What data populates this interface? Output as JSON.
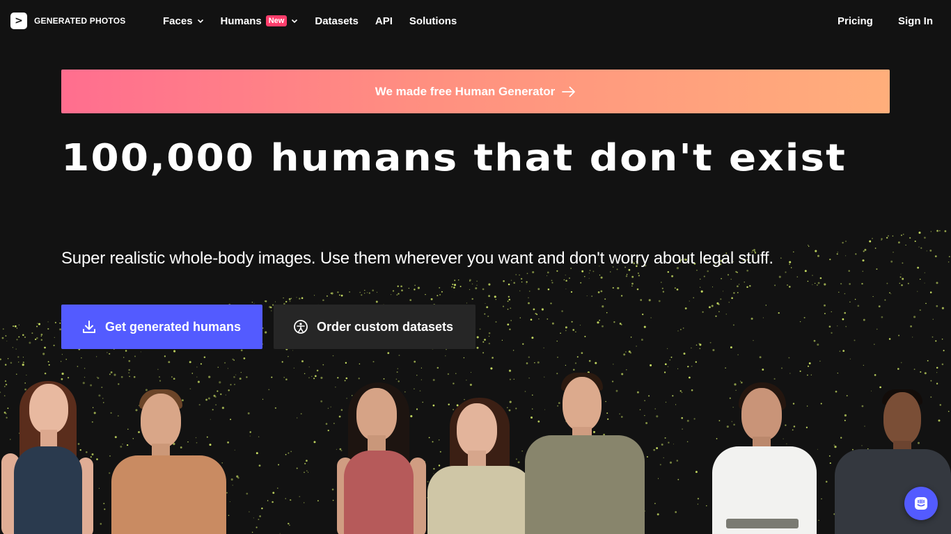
{
  "header": {
    "logo_symbol": ">",
    "logo_text": "GENERATED PHOTOS",
    "nav": [
      {
        "label": "Faces",
        "has_dropdown": true
      },
      {
        "label": "Humans",
        "badge": "New",
        "has_dropdown": true
      },
      {
        "label": "Datasets"
      },
      {
        "label": "API"
      },
      {
        "label": "Solutions"
      }
    ],
    "pricing_label": "Pricing",
    "signin_label": "Sign In"
  },
  "promo": {
    "label": "We made free Human Generator",
    "arrow_icon": "arrow-right-icon"
  },
  "hero": {
    "headline": "100,000 Humans that don't exist",
    "subline": "Super realistic whole-body images. Use them wherever you want and don't worry about legal stuff."
  },
  "buttons": {
    "primary_label": "Get generated humans",
    "primary_icon": "download-icon",
    "secondary_label": "Order custom datasets",
    "secondary_icon": "dataset-icon"
  },
  "chat": {
    "icon": "chat-icon"
  },
  "colors": {
    "background": "#121212",
    "accent": "#535bff",
    "badge": "#ff3e6c",
    "promo_start": "#ff6e8f",
    "promo_end": "#ffae7b",
    "sparkle": "#d8f06a"
  }
}
